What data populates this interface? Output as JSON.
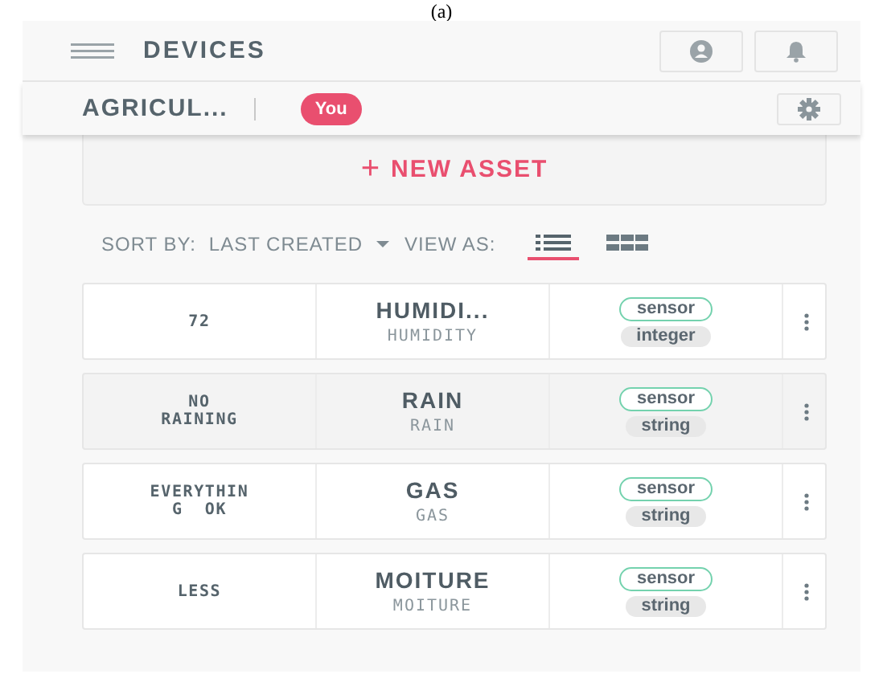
{
  "caption": "(a)",
  "header": {
    "title": "DEVICES"
  },
  "subheader": {
    "org": "AGRICUL...",
    "badge": "You"
  },
  "new_asset": {
    "icon": "+",
    "label": "NEW ASSET"
  },
  "sort": {
    "label": "SORT BY:",
    "value": "LAST CREATED",
    "view_label": "VIEW AS:",
    "views": [
      {
        "kind": "list",
        "selected": true
      },
      {
        "kind": "grid",
        "selected": false
      }
    ]
  },
  "rows": [
    {
      "value": "72",
      "name": "HUMIDI...",
      "key": "HUMIDITY",
      "tags": [
        "sensor",
        "integer"
      ],
      "highlighted": false
    },
    {
      "value": "NO\nRAINING",
      "name": "RAIN",
      "key": "RAIN",
      "tags": [
        "sensor",
        "string"
      ],
      "highlighted": true
    },
    {
      "value": "EVERYTHIN\nG  OK",
      "name": "GAS",
      "key": "GAS",
      "tags": [
        "sensor",
        "string"
      ],
      "highlighted": false
    },
    {
      "value": "LESS",
      "name": "MOITURE",
      "key": "MOITURE",
      "tags": [
        "sensor",
        "string"
      ],
      "highlighted": false
    }
  ]
}
